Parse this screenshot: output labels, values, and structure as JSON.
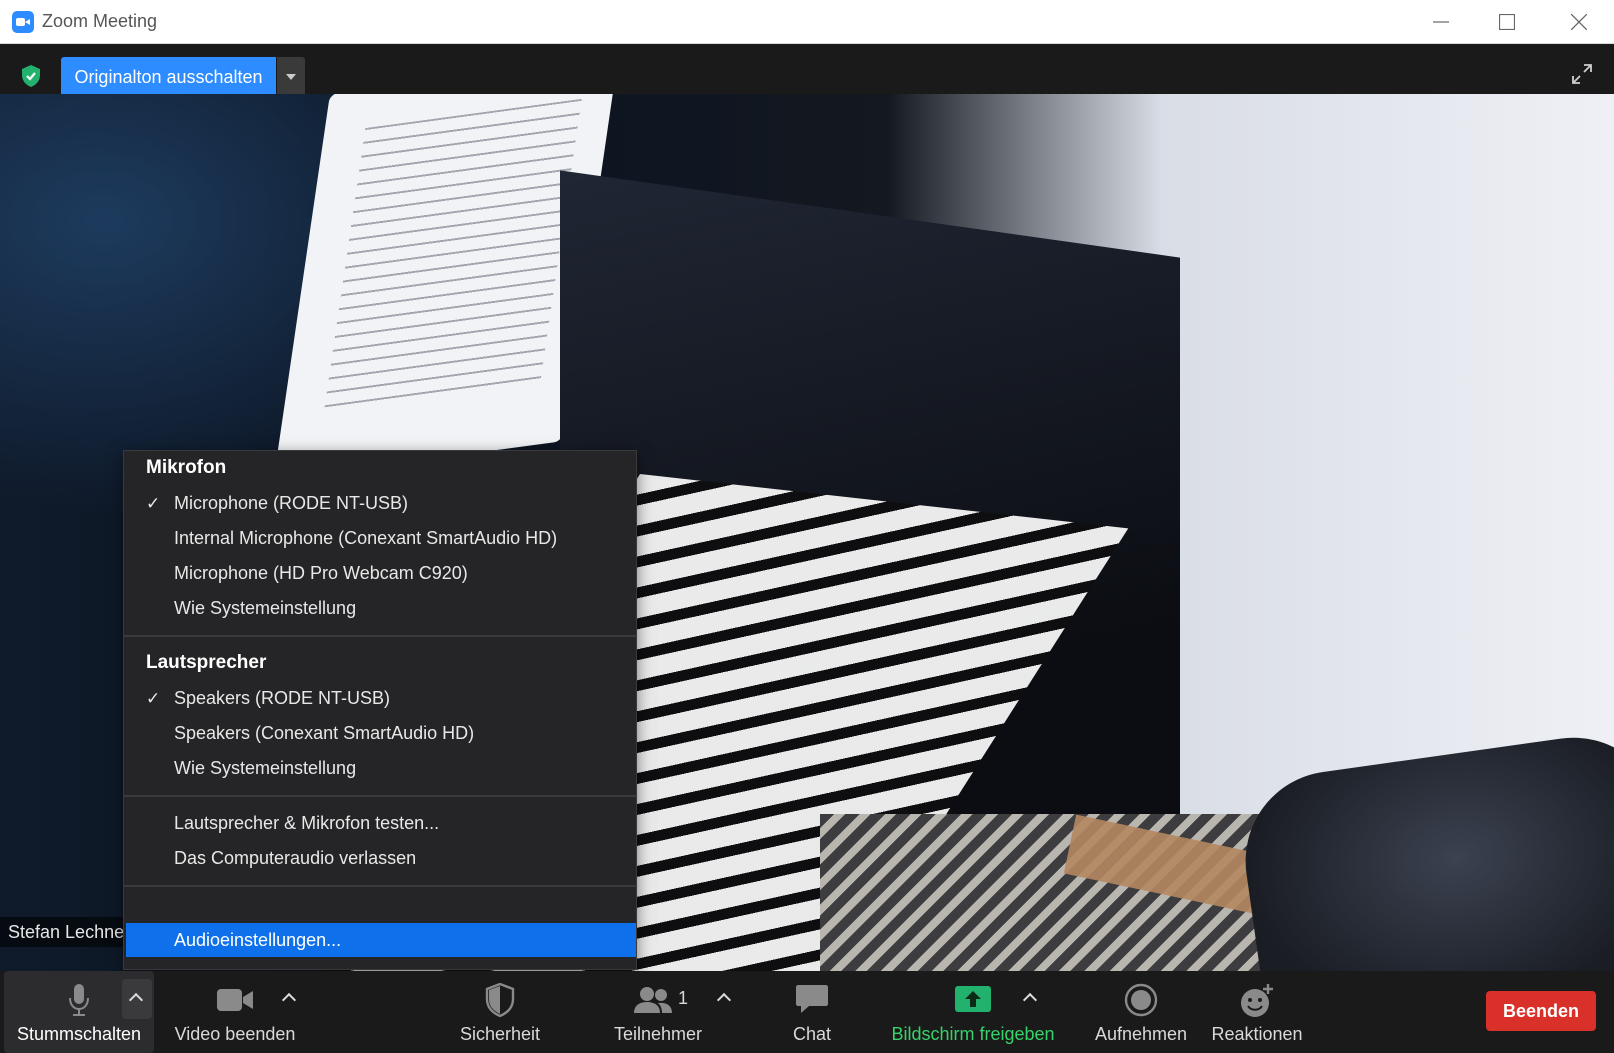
{
  "window": {
    "title": "Zoom Meeting"
  },
  "top_strip": {
    "original_sound_button": "Originalton ausschalten"
  },
  "video": {
    "participant_name": "Stefan Lechne"
  },
  "audio_menu": {
    "microphone_header": "Mikrofon",
    "microphones": [
      {
        "label": "Microphone (RODE NT-USB)",
        "checked": true
      },
      {
        "label": "Internal Microphone (Conexant SmartAudio HD)",
        "checked": false
      },
      {
        "label": "Microphone (HD Pro Webcam C920)",
        "checked": false
      },
      {
        "label": "Wie Systemeinstellung",
        "checked": false
      }
    ],
    "speaker_header": "Lautsprecher",
    "speakers": [
      {
        "label": "Speakers (RODE NT-USB)",
        "checked": true
      },
      {
        "label": "Speakers (Conexant SmartAudio HD)",
        "checked": false
      },
      {
        "label": "Wie Systemeinstellung",
        "checked": false
      }
    ],
    "test_label": "Lautsprecher & Mikrofon testen...",
    "leave_audio_label": "Das Computeraudio verlassen",
    "settings_label": "Audioeinstellungen...",
    "check_glyph": "✓"
  },
  "toolbar": {
    "mute": "Stummschalten",
    "video": "Video beenden",
    "security": "Sicherheit",
    "participants": "Teilnehmer",
    "participants_count": "1",
    "chat": "Chat",
    "share": "Bildschirm freigeben",
    "record": "Aufnehmen",
    "reactions": "Reaktionen",
    "end": "Beenden"
  },
  "colors": {
    "accent_blue": "#2d8cff",
    "menu_highlight": "#0e71eb",
    "share_green": "#36d36a",
    "end_red": "#d9302a"
  }
}
